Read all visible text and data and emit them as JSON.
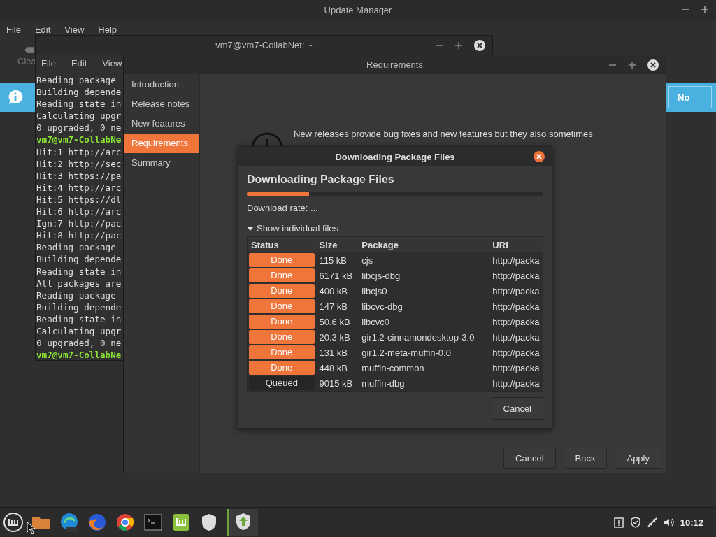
{
  "update_manager": {
    "title": "Update Manager",
    "menu": [
      "File",
      "Edit",
      "View",
      "Help"
    ],
    "toolbar_label": "Clea",
    "info_bar": {
      "button": "No"
    }
  },
  "terminal": {
    "title": "vm7@vm7-CollabNet: ~",
    "menu": [
      "File",
      "Edit",
      "View"
    ],
    "lines": [
      {
        "text": "Reading package",
        "kind": "output"
      },
      {
        "text": "Building depende",
        "kind": "output"
      },
      {
        "text": "Reading state in",
        "kind": "output"
      },
      {
        "text": "Calculating upgr",
        "kind": "output"
      },
      {
        "text": "0 upgraded, 0 ne",
        "kind": "output"
      },
      {
        "text": "vm7@vm7-CollabNe",
        "kind": "prompt"
      },
      {
        "text": "Hit:1 http://arc",
        "kind": "output"
      },
      {
        "text": "Hit:2 http://sec",
        "kind": "output"
      },
      {
        "text": "Hit:3 https://pa",
        "kind": "output"
      },
      {
        "text": "Hit:4 http://arc",
        "kind": "output"
      },
      {
        "text": "Hit:5 https://dl",
        "kind": "output"
      },
      {
        "text": "Hit:6 http://arc",
        "kind": "output"
      },
      {
        "text": "Ign:7 http://pac",
        "kind": "output"
      },
      {
        "text": "Hit:8 http://pac",
        "kind": "output"
      },
      {
        "text": "Reading package",
        "kind": "output"
      },
      {
        "text": "Building depende",
        "kind": "output"
      },
      {
        "text": "Reading state in",
        "kind": "output"
      },
      {
        "text": "All packages are",
        "kind": "output"
      },
      {
        "text": "Reading package",
        "kind": "output"
      },
      {
        "text": "Building depende",
        "kind": "output"
      },
      {
        "text": "Reading state in",
        "kind": "output"
      },
      {
        "text": "Calculating upgr",
        "kind": "output"
      },
      {
        "text": "0 upgraded, 0 ne",
        "kind": "output"
      },
      {
        "text": "vm7@vm7-CollabNe",
        "kind": "prompt"
      }
    ]
  },
  "requirements": {
    "title": "Requirements",
    "sidebar": [
      {
        "label": "Introduction",
        "selected": false
      },
      {
        "label": "Release notes",
        "selected": false
      },
      {
        "label": "New features",
        "selected": false
      },
      {
        "label": "Requirements",
        "selected": true
      },
      {
        "label": "Summary",
        "selected": false
      }
    ],
    "text_lines": [
      "New releases provide bug fixes and new features but they also sometimes"
    ],
    "buttons": [
      "Cancel",
      "Back",
      "Apply"
    ]
  },
  "download_dialog": {
    "title": "Downloading Package Files",
    "heading": "Downloading Package Files",
    "progress": {
      "level": 0.21
    },
    "rate": "Download rate: ...",
    "expander": {
      "label": "Show individual files",
      "expanded": true
    },
    "table": {
      "columns": [
        "Status",
        "Size",
        "Package",
        "URI"
      ],
      "rows": [
        {
          "status": "Done",
          "kind": "done",
          "size": "115 kB",
          "package": "cjs",
          "uri": "http://packa"
        },
        {
          "status": "Done",
          "kind": "done",
          "size": "6171 kB",
          "package": "libcjs-dbg",
          "uri": "http://packa"
        },
        {
          "status": "Done",
          "kind": "done",
          "size": "400 kB",
          "package": "libcjs0",
          "uri": "http://packa"
        },
        {
          "status": "Done",
          "kind": "done",
          "size": "147 kB",
          "package": "libcvc-dbg",
          "uri": "http://packa"
        },
        {
          "status": "Done",
          "kind": "done",
          "size": "50.6 kB",
          "package": "libcvc0",
          "uri": "http://packa"
        },
        {
          "status": "Done",
          "kind": "done",
          "size": "20.3 kB",
          "package": "gir1.2-cinnamondesktop-3.0",
          "uri": "http://packa"
        },
        {
          "status": "Done",
          "kind": "done",
          "size": "131 kB",
          "package": "gir1.2-meta-muffin-0.0",
          "uri": "http://packa"
        },
        {
          "status": "Done",
          "kind": "done",
          "size": "448 kB",
          "package": "muffin-common",
          "uri": "http://packa"
        },
        {
          "status": "Queued",
          "kind": "queued",
          "size": "9015 kB",
          "package": "muffin-dbg",
          "uri": "http://packa"
        }
      ]
    },
    "button": "Cancel"
  },
  "taskbar": {
    "clock": "10:12"
  }
}
